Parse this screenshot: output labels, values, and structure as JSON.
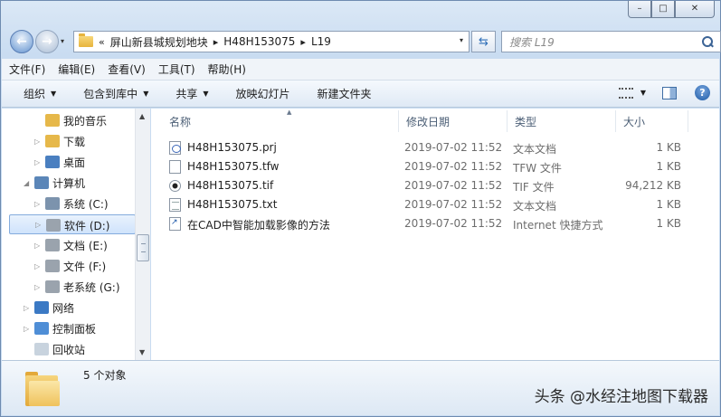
{
  "window": {
    "caption_buttons": {
      "minimize": "–",
      "maximize": "□",
      "close": "✕"
    }
  },
  "navigation": {
    "back_icon": "back-arrow-icon",
    "forward_icon": "forward-arrow-icon",
    "back_glyph": "←",
    "forward_glyph": "→",
    "history_glyph": "▾"
  },
  "address": {
    "overflow": "«",
    "crumbs": [
      "屏山新县城规划地块",
      "H48H153075",
      "L19"
    ],
    "separator": "▸",
    "dropdown_glyph": "▾",
    "refresh_glyph": "⇆"
  },
  "search": {
    "placeholder": "搜索 L19"
  },
  "menu": [
    "文件(F)",
    "编辑(E)",
    "查看(V)",
    "工具(T)",
    "帮助(H)"
  ],
  "toolbar": {
    "organize": "组织",
    "include_in_library": "包含到库中",
    "share": "共享",
    "slideshow": "放映幻灯片",
    "new_folder": "新建文件夹",
    "dropdown_glyph": "▼",
    "help_glyph": "?"
  },
  "nav_tree": [
    {
      "label": "我的音乐",
      "icon": "music-folder-icon",
      "color": "#e6b84a"
    },
    {
      "label": "下载",
      "icon": "downloads-folder-icon",
      "color": "#e6b84a"
    },
    {
      "label": "桌面",
      "icon": "desktop-folder-icon",
      "color": "#4a7fc0"
    },
    {
      "label": "计算机",
      "icon": "computer-icon",
      "color": "#5b86b8"
    },
    {
      "label": "系统 (C:)",
      "icon": "system-drive-icon",
      "color": "#7c93ad"
    },
    {
      "label": "软件 (D:)",
      "icon": "drive-icon",
      "color": "#9aa3ad"
    },
    {
      "label": "文档 (E:)",
      "icon": "drive-icon",
      "color": "#9aa3ad"
    },
    {
      "label": "文件 (F:)",
      "icon": "drive-icon",
      "color": "#9aa3ad"
    },
    {
      "label": "老系统 (G:)",
      "icon": "drive-icon",
      "color": "#9aa3ad"
    },
    {
      "label": "网络",
      "icon": "network-icon",
      "color": "#3b79c4"
    },
    {
      "label": "控制面板",
      "icon": "control-panel-icon",
      "color": "#4f8ed6"
    },
    {
      "label": "回收站",
      "icon": "recycle-bin-icon",
      "color": "#c8d3de"
    }
  ],
  "nav_glyphs": {
    "collapsed": "▷",
    "expanded": "◢",
    "scroll_up": "▲",
    "scroll_down": "▼"
  },
  "columns": {
    "name": "名称",
    "modified": "修改日期",
    "type": "类型",
    "size": "大小",
    "sort_glyph": "▲"
  },
  "files": [
    {
      "name": "H48H153075.prj",
      "modified": "2019-07-02 11:52",
      "type": "文本文档",
      "size": "1 KB",
      "icon": "prj-file-icon"
    },
    {
      "name": "H48H153075.tfw",
      "modified": "2019-07-02 11:52",
      "type": "TFW 文件",
      "size": "1 KB",
      "icon": "tfw-file-icon"
    },
    {
      "name": "H48H153075.tif",
      "modified": "2019-07-02 11:52",
      "type": "TIF 文件",
      "size": "94,212 KB",
      "icon": "tif-file-icon"
    },
    {
      "name": "H48H153075.txt",
      "modified": "2019-07-02 11:52",
      "type": "文本文档",
      "size": "1 KB",
      "icon": "txt-file-icon"
    },
    {
      "name": "在CAD中智能加载影像的方法",
      "modified": "2019-07-02 11:52",
      "type": "Internet 快捷方式",
      "size": "1 KB",
      "icon": "internet-shortcut-icon"
    }
  ],
  "status": {
    "item_count": "5 个对象"
  },
  "watermark": "头条 @水经注地图下载器"
}
